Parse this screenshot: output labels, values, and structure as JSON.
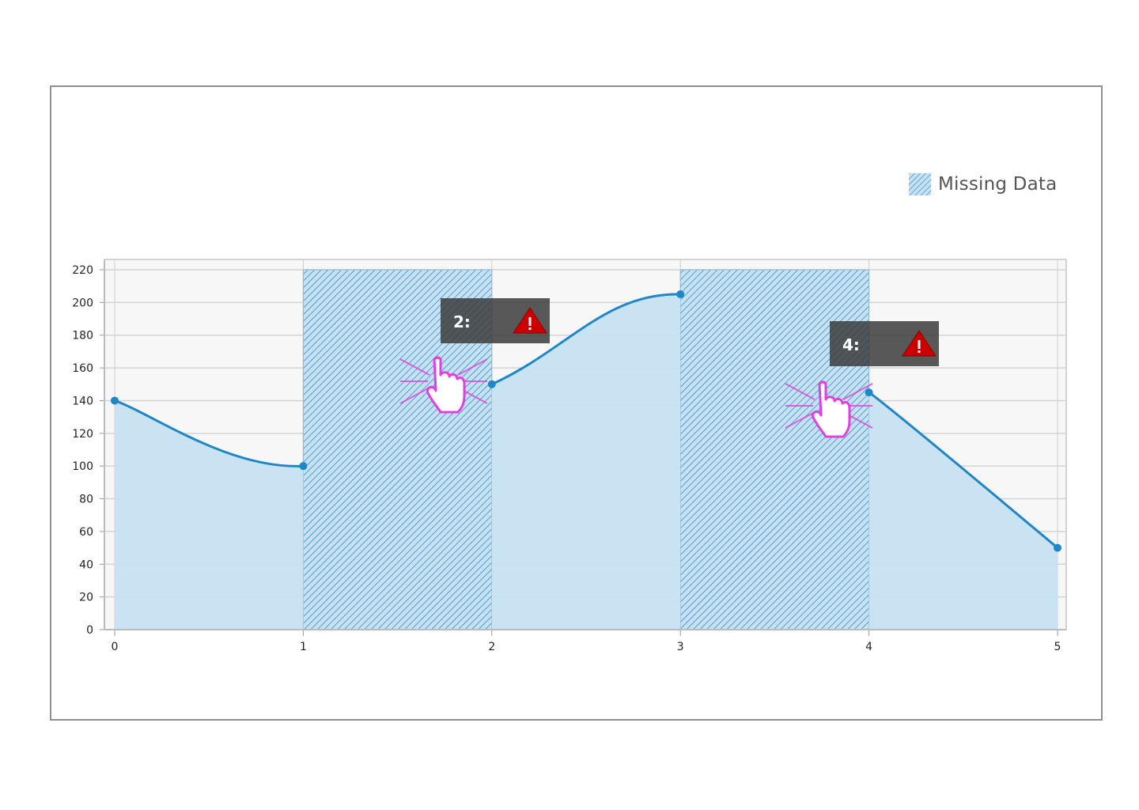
{
  "colors": {
    "line": "#1f87c8",
    "area": "#c7e1f1",
    "hatch": "#2f8fd0",
    "plot_bg": "#f7f7f7",
    "grid": "#d3d3d3",
    "tooltip_bg": "#3c3c3c",
    "warning": "#cc0000",
    "cursor_glow": "#e040e0"
  },
  "legend": {
    "label": "Missing Data",
    "icon": "hatched-swatch"
  },
  "chart_data": {
    "type": "area",
    "x": [
      0,
      1,
      2,
      3,
      4,
      5
    ],
    "series": [
      {
        "values": [
          140,
          100,
          150,
          205,
          145,
          50
        ],
        "missing_segments": [
          [
            1,
            2
          ],
          [
            3,
            4
          ]
        ]
      }
    ],
    "xlim": [
      0,
      5
    ],
    "ylim": [
      0,
      220
    ],
    "xticks": [
      0,
      1,
      2,
      3,
      4,
      5
    ],
    "yticks": [
      0,
      20,
      40,
      60,
      80,
      100,
      120,
      140,
      160,
      180,
      200,
      220
    ],
    "grid": true,
    "legend_position": "top-right",
    "annotations": [
      {
        "label": "2:",
        "x": 2,
        "icon": "warning-icon",
        "cursor": "pointer-hand-icon"
      },
      {
        "label": "4:",
        "x": 4,
        "icon": "warning-icon",
        "cursor": "pointer-hand-icon"
      }
    ]
  }
}
